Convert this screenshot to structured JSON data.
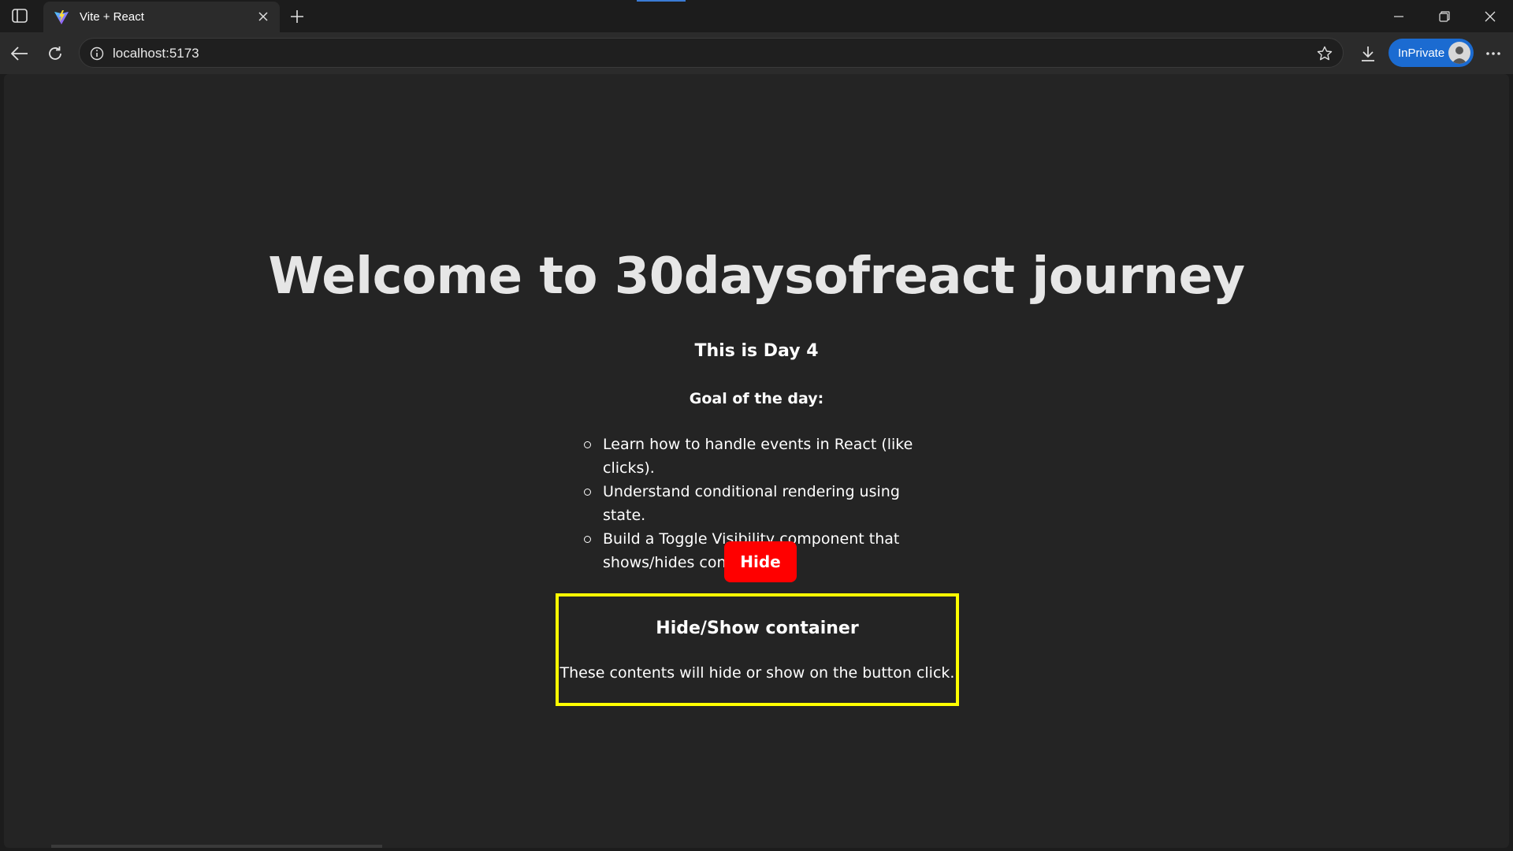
{
  "browser": {
    "tab": {
      "title": "Vite + React",
      "favicon": "vite-logo-icon"
    },
    "address": {
      "url": "localhost:5173"
    },
    "profile": {
      "label": "InPrivate"
    },
    "colors": {
      "accent": "#1b6bd1"
    }
  },
  "page": {
    "title": "Welcome to 30daysofreact journey",
    "day_heading": "This is Day 4",
    "goal_heading": "Goal of the day:",
    "goals": [
      "Learn how to handle events in React (like clicks).",
      "Understand conditional rendering using state.",
      "Build a Toggle Visibility component that shows/hides content."
    ],
    "toggle_button": {
      "label": "Hide",
      "color": "#ff0000"
    },
    "container": {
      "title": "Hide/Show container",
      "text": "These contents will hide or show on the button click.",
      "border_color": "#ffff00"
    }
  }
}
